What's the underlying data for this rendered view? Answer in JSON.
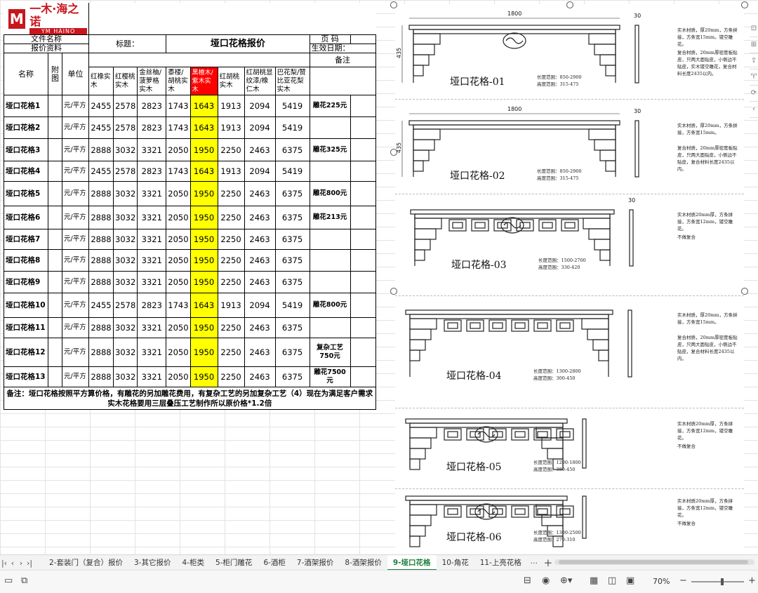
{
  "header": {
    "logo_cn": "一木·海之诺",
    "logo_en": "YM HAINO",
    "file_name_label": "文件名称",
    "quote_label": "报价资料",
    "title_label": "标题：",
    "title": "垭口花格报价",
    "page_label": "页  码",
    "effective_label": "生效日期：",
    "remarks_label": "备注"
  },
  "columns": {
    "name": "名称",
    "image": "附图",
    "unit": "单位",
    "woods": [
      "红橡实木",
      "红樱桃实木",
      "金丝柚/菠萝格实木",
      "黍楼/胡桃实木",
      "黑檀木/紫木实木",
      "红胡桃实木",
      "红胡桃显纹漆/橡仁木",
      "巴花梨/赞比亚花梨实木"
    ]
  },
  "rows": [
    {
      "name": "垭口花格1",
      "unit": "元/平方",
      "prices": [
        "2455",
        "2578",
        "2823",
        "1743",
        "1643",
        "1913",
        "2094",
        "5419"
      ],
      "note": "雕花225元"
    },
    {
      "name": "垭口花格2",
      "unit": "元/平方",
      "prices": [
        "2455",
        "2578",
        "2823",
        "1743",
        "1643",
        "1913",
        "2094",
        "5419"
      ],
      "note": ""
    },
    {
      "name": "垭口花格3",
      "unit": "元/平方",
      "prices": [
        "2888",
        "3032",
        "3321",
        "2050",
        "1950",
        "2250",
        "2463",
        "6375"
      ],
      "note": "雕花325元"
    },
    {
      "name": "垭口花格4",
      "unit": "元/平方",
      "prices": [
        "2455",
        "2578",
        "2823",
        "1743",
        "1643",
        "1913",
        "2094",
        "5419"
      ],
      "note": ""
    },
    {
      "name": "垭口花格5",
      "unit": "元/平方",
      "prices": [
        "2888",
        "3032",
        "3321",
        "2050",
        "1950",
        "2250",
        "2463",
        "6375"
      ],
      "note": "雕花800元"
    },
    {
      "name": "垭口花格6",
      "unit": "元/平方",
      "prices": [
        "2888",
        "3032",
        "3321",
        "2050",
        "1950",
        "2250",
        "2463",
        "6375"
      ],
      "note": "雕花213元"
    },
    {
      "name": "垭口花格7",
      "unit": "元/平方",
      "prices": [
        "2888",
        "3032",
        "3321",
        "2050",
        "1950",
        "2250",
        "2463",
        "6375"
      ],
      "note": ""
    },
    {
      "name": "垭口花格8",
      "unit": "元/平方",
      "prices": [
        "2888",
        "3032",
        "3321",
        "2050",
        "1950",
        "2250",
        "2463",
        "6375"
      ],
      "note": ""
    },
    {
      "name": "垭口花格9",
      "unit": "元/平方",
      "prices": [
        "2888",
        "3032",
        "3321",
        "2050",
        "1950",
        "2250",
        "2463",
        "6375"
      ],
      "note": ""
    },
    {
      "name": "垭口花格10",
      "unit": "元/平方",
      "prices": [
        "2455",
        "2578",
        "2823",
        "1743",
        "1643",
        "1913",
        "2094",
        "5419"
      ],
      "note": "雕花800元"
    },
    {
      "name": "垭口花格11",
      "unit": "元/平方",
      "prices": [
        "2888",
        "3032",
        "3321",
        "2050",
        "1950",
        "2250",
        "2463",
        "6375"
      ],
      "note": ""
    },
    {
      "name": "垭口花格12",
      "unit": "元/平方",
      "prices": [
        "2888",
        "3032",
        "3321",
        "2050",
        "1950",
        "2250",
        "2463",
        "6375"
      ],
      "note": "复杂工艺750元"
    },
    {
      "name": "垭口花格13",
      "unit": "元/平方",
      "prices": [
        "2888",
        "3032",
        "3321",
        "2050",
        "1950",
        "2250",
        "2463",
        "6375"
      ],
      "note": "雕花7500元"
    }
  ],
  "footnote": "备注：垭口花格按照平方算价格，有雕花的另加雕花费用，有复杂工艺的另加复杂工艺（4）现在为满足客户需求实木花格要用三层叠压工艺制作所以原价格*1.2倍",
  "drawings": [
    {
      "title": "垭口花格-01",
      "width_dim": "1800",
      "height_dim": "435",
      "depth_dim": "30",
      "range": [
        "长度范围：850-2900",
        "高度范围：315-475"
      ],
      "notes": [
        "实木材质，厚20mm，方条拼接，方条宽15mm。镂空雕花。",
        "复合材质，20mm厚密度板贴皮，只两大面贴皮，小侧边不贴皮，实木镂空雕花，复合材料长度2435以内。"
      ]
    },
    {
      "title": "垭口花格-02",
      "width_dim": "1800",
      "height_dim": "435",
      "depth_dim": "30",
      "range": [
        "长度范围：850-2900",
        "高度范围：315-475"
      ],
      "notes": [
        "实木材质，厚20mm，方条拼接，方条宽15mm。",
        "复合材质，20mm厚密度板贴皮，只两大面贴皮，小侧边不贴皮，复合材料长度2435以内。"
      ]
    },
    {
      "title": "垭口花格-03",
      "width_dim": "",
      "height_dim": "",
      "depth_dim": "30",
      "range": [
        "长度范围：1500-2700",
        "高度范围：330-420"
      ],
      "notes": [
        "实木材质20mm厚，方条拼接，方条宽12mm，镂空雕花。",
        "不做复合"
      ]
    },
    {
      "title": "垭口花格-04",
      "width_dim": "",
      "height_dim": "",
      "depth_dim": "",
      "range": [
        "长度范围：1300-2800",
        "高度范围：300-450"
      ],
      "notes": [
        "实木材质，厚20mm，方条拼接，方条宽15mm。",
        "复合材质，20mm厚密度板贴皮，只两大面贴皮，小侧边不贴皮，复合材料长度2435以内。"
      ]
    },
    {
      "title": "垭口花格-05",
      "width_dim": "",
      "height_dim": "",
      "depth_dim": "",
      "range": [
        "长度范围：1200-1800",
        "高度范围：380-450"
      ],
      "notes": [
        "实木材质20mm厚，方条拼接，方条宽12mm，镂空雕花。",
        "不做复合"
      ]
    },
    {
      "title": "垭口花格-06",
      "width_dim": "",
      "height_dim": "",
      "depth_dim": "",
      "range": [
        "长度范围：1300-2500",
        "高度范围：270-310"
      ],
      "notes": [
        "实木材质20mm厚，方条拼接，方条宽12mm，镂空雕花。",
        "不做复合"
      ]
    }
  ],
  "sheet_tabs": [
    {
      "label": "2-套装门（复合）报价",
      "active": false
    },
    {
      "label": "3-其它报价",
      "active": false
    },
    {
      "label": "4-柜类",
      "active": false
    },
    {
      "label": "5-柜门雕花",
      "active": false
    },
    {
      "label": "6-酒柜",
      "active": false
    },
    {
      "label": "7-酒架报价",
      "active": false
    },
    {
      "label": "8-酒架报价",
      "active": false
    },
    {
      "label": "9-垭口花格",
      "active": true
    },
    {
      "label": "10-角花",
      "active": false
    },
    {
      "label": "11-上亮花格",
      "active": false
    }
  ],
  "tabbar": {
    "more": "···",
    "add": "+"
  },
  "status": {
    "zoom": "70%"
  },
  "colors": {
    "highlight": "#ffff00",
    "header_red": "#ff0000",
    "logo_red": "#c8161d",
    "active_tab": "#1a7f3c"
  }
}
